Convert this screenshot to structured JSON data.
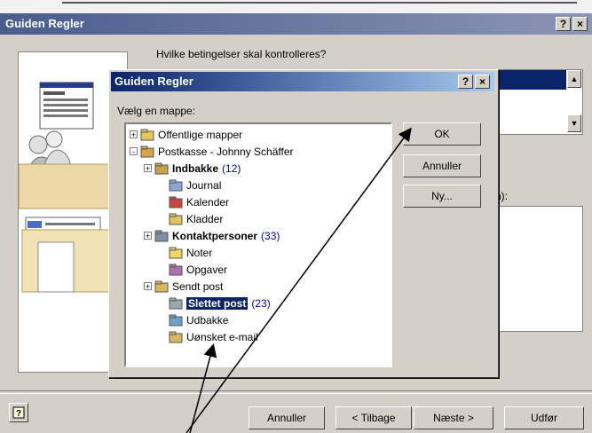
{
  "outer": {
    "title": "Guiden Regler",
    "help_glyph": "?",
    "close_glyph": "×",
    "question": "Hvilke betingelser skal kontrolleres?",
    "description_label_fragment": "n):",
    "buttons": {
      "cancel": "Annuller",
      "back": "< Tilbage",
      "next": "Næste >",
      "finish": "Udfør"
    }
  },
  "inner": {
    "title": "Guiden Regler",
    "help_glyph": "?",
    "close_glyph": "×",
    "prompt": "Vælg en mappe:",
    "buttons": {
      "ok": "OK",
      "cancel": "Annuller",
      "new": "Ny..."
    },
    "tree": [
      {
        "label": "Offentlige mapper",
        "count": "",
        "bold": false,
        "selected": false,
        "icon": "public-folders-icon"
      },
      {
        "label": "Postkasse - Johnny Schäffer",
        "count": "",
        "bold": false,
        "selected": false,
        "icon": "mailbox-icon"
      },
      {
        "label": "Indbakke",
        "count": "(12)",
        "bold": true,
        "selected": false,
        "icon": "inbox-icon"
      },
      {
        "label": "Journal",
        "count": "",
        "bold": false,
        "selected": false,
        "icon": "journal-icon"
      },
      {
        "label": "Kalender",
        "count": "",
        "bold": false,
        "selected": false,
        "icon": "calendar-icon"
      },
      {
        "label": "Kladder",
        "count": "",
        "bold": false,
        "selected": false,
        "icon": "drafts-icon"
      },
      {
        "label": "Kontaktpersoner",
        "count": "(33)",
        "bold": true,
        "selected": false,
        "icon": "contacts-icon"
      },
      {
        "label": "Noter",
        "count": "",
        "bold": false,
        "selected": false,
        "icon": "notes-icon"
      },
      {
        "label": "Opgaver",
        "count": "",
        "bold": false,
        "selected": false,
        "icon": "tasks-icon"
      },
      {
        "label": "Sendt post",
        "count": "",
        "bold": false,
        "selected": false,
        "icon": "sent-items-icon"
      },
      {
        "label": "Slettet post",
        "count": "(23)",
        "bold": true,
        "selected": true,
        "icon": "deleted-items-icon"
      },
      {
        "label": "Udbakke",
        "count": "",
        "bold": false,
        "selected": false,
        "icon": "outbox-icon"
      },
      {
        "label": "Uønsket e-mail",
        "count": "",
        "bold": false,
        "selected": false,
        "icon": "junk-mail-icon"
      }
    ]
  },
  "colors": {
    "inner_titlebar": "#0a246a",
    "selection": "#0a246a",
    "count_text": "#0000cc"
  }
}
